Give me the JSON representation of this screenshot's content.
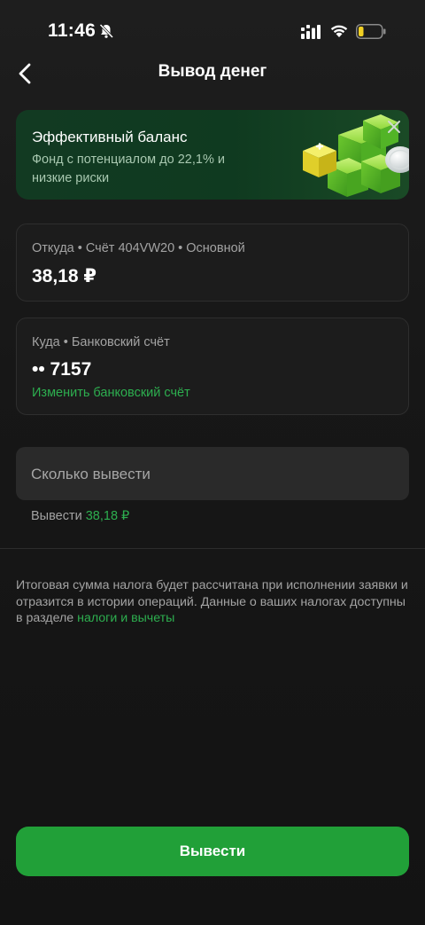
{
  "status_bar": {
    "time": "11:46"
  },
  "header": {
    "title": "Вывод денег"
  },
  "promo": {
    "title": "Эффективный баланс",
    "subtitle": "Фонд с потенциалом до 22,1% и низкие риски"
  },
  "from_card": {
    "label": "Откуда • Счёт 404VW20 • Основной",
    "amount": "38,18 ₽"
  },
  "to_card": {
    "label": "Куда • Банковский счёт",
    "account": "•• 7157",
    "change_link": "Изменить банковский счёт"
  },
  "amount_input": {
    "placeholder": "Сколько вывести",
    "hint_prefix": "Вывести",
    "hint_value": "38,18 ₽"
  },
  "tax_note": {
    "text": "Итоговая сумма налога будет рассчитана при исполнении заявки и отразится в истории операций. Данные о ваших налогах доступны в разделе ",
    "link": "налоги и вычеты"
  },
  "actions": {
    "withdraw_label": "Вывести"
  },
  "colors": {
    "accent_green": "#21a038",
    "link_green": "#2dae4f",
    "background": "#141414"
  }
}
